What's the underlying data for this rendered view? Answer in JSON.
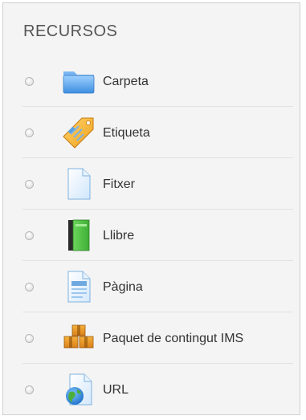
{
  "section": {
    "title": "RECURSOS"
  },
  "resources": [
    {
      "label": "Carpeta",
      "icon": "folder-icon"
    },
    {
      "label": "Etiqueta",
      "icon": "tag-icon"
    },
    {
      "label": "Fitxer",
      "icon": "file-icon"
    },
    {
      "label": "Llibre",
      "icon": "book-icon"
    },
    {
      "label": "Pàgina",
      "icon": "page-icon"
    },
    {
      "label": "Paquet de contingut IMS",
      "icon": "package-icon"
    },
    {
      "label": "URL",
      "icon": "url-globe-icon"
    }
  ]
}
